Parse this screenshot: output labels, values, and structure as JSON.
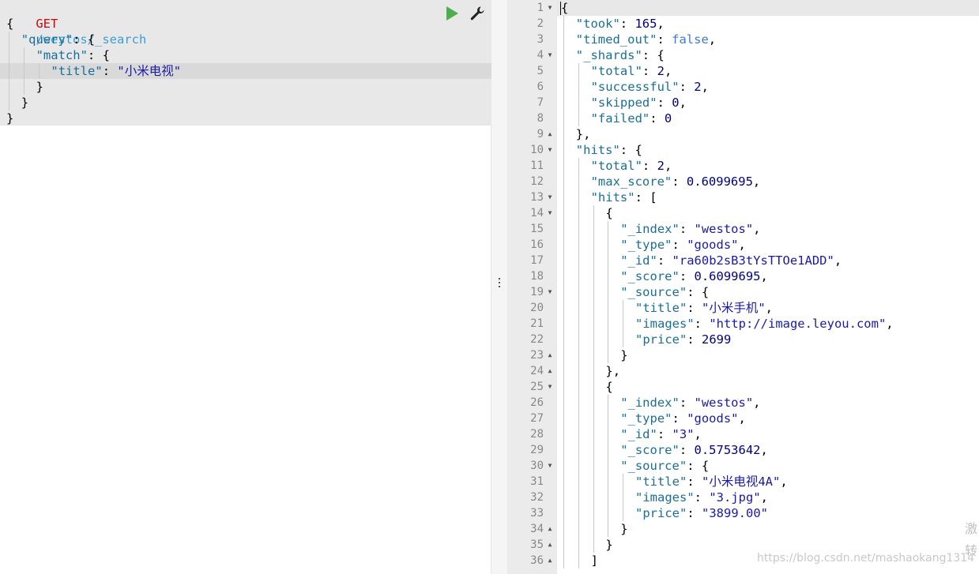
{
  "request": {
    "method": "GET",
    "path": "/westos/_search",
    "lines": [
      {
        "indent": 0,
        "parts": [
          {
            "t": "{",
            "c": ""
          }
        ]
      },
      {
        "indent": 1,
        "parts": [
          {
            "t": "\"query\"",
            "c": "key"
          },
          {
            "t": ": {",
            "c": ""
          }
        ]
      },
      {
        "indent": 2,
        "parts": [
          {
            "t": "\"match\"",
            "c": "key"
          },
          {
            "t": ": {",
            "c": ""
          }
        ]
      },
      {
        "indent": 3,
        "parts": [
          {
            "t": "\"title\"",
            "c": "key"
          },
          {
            "t": ": ",
            "c": ""
          },
          {
            "t": "\"小米电视\"",
            "c": "str"
          }
        ]
      },
      {
        "indent": 2,
        "parts": [
          {
            "t": "}",
            "c": ""
          }
        ]
      },
      {
        "indent": 1,
        "parts": [
          {
            "t": "}",
            "c": ""
          }
        ]
      },
      {
        "indent": 0,
        "parts": [
          {
            "t": "}",
            "c": ""
          }
        ]
      }
    ],
    "icons": {
      "run": "play-icon",
      "settings": "wrench-icon"
    },
    "colors": {
      "run": "#4cae4c",
      "method": "#c5060b",
      "path": "#3a9fd6"
    }
  },
  "response": {
    "lines": [
      {
        "n": "1",
        "fold": "open",
        "indent": 0,
        "parts": [
          {
            "t": "{",
            "c": ""
          }
        ]
      },
      {
        "n": "2",
        "indent": 1,
        "parts": [
          {
            "t": "\"took\"",
            "c": "key"
          },
          {
            "t": ": ",
            "c": ""
          },
          {
            "t": "165",
            "c": "num"
          },
          {
            "t": ",",
            "c": ""
          }
        ]
      },
      {
        "n": "3",
        "indent": 1,
        "parts": [
          {
            "t": "\"timed_out\"",
            "c": "key"
          },
          {
            "t": ": ",
            "c": ""
          },
          {
            "t": "false",
            "c": "bool"
          },
          {
            "t": ",",
            "c": ""
          }
        ]
      },
      {
        "n": "4",
        "fold": "open",
        "indent": 1,
        "parts": [
          {
            "t": "\"_shards\"",
            "c": "key"
          },
          {
            "t": ": {",
            "c": ""
          }
        ]
      },
      {
        "n": "5",
        "indent": 2,
        "parts": [
          {
            "t": "\"total\"",
            "c": "key"
          },
          {
            "t": ": ",
            "c": ""
          },
          {
            "t": "2",
            "c": "num"
          },
          {
            "t": ",",
            "c": ""
          }
        ]
      },
      {
        "n": "6",
        "indent": 2,
        "parts": [
          {
            "t": "\"successful\"",
            "c": "key"
          },
          {
            "t": ": ",
            "c": ""
          },
          {
            "t": "2",
            "c": "num"
          },
          {
            "t": ",",
            "c": ""
          }
        ]
      },
      {
        "n": "7",
        "indent": 2,
        "parts": [
          {
            "t": "\"skipped\"",
            "c": "key"
          },
          {
            "t": ": ",
            "c": ""
          },
          {
            "t": "0",
            "c": "num"
          },
          {
            "t": ",",
            "c": ""
          }
        ]
      },
      {
        "n": "8",
        "indent": 2,
        "parts": [
          {
            "t": "\"failed\"",
            "c": "key"
          },
          {
            "t": ": ",
            "c": ""
          },
          {
            "t": "0",
            "c": "num"
          }
        ]
      },
      {
        "n": "9",
        "fold": "close",
        "indent": 1,
        "parts": [
          {
            "t": "},",
            "c": ""
          }
        ]
      },
      {
        "n": "10",
        "fold": "open",
        "indent": 1,
        "parts": [
          {
            "t": "\"hits\"",
            "c": "key"
          },
          {
            "t": ": {",
            "c": ""
          }
        ]
      },
      {
        "n": "11",
        "indent": 2,
        "parts": [
          {
            "t": "\"total\"",
            "c": "key"
          },
          {
            "t": ": ",
            "c": ""
          },
          {
            "t": "2",
            "c": "num"
          },
          {
            "t": ",",
            "c": ""
          }
        ]
      },
      {
        "n": "12",
        "indent": 2,
        "parts": [
          {
            "t": "\"max_score\"",
            "c": "key"
          },
          {
            "t": ": ",
            "c": ""
          },
          {
            "t": "0.6099695",
            "c": "num"
          },
          {
            "t": ",",
            "c": ""
          }
        ]
      },
      {
        "n": "13",
        "fold": "open",
        "indent": 2,
        "parts": [
          {
            "t": "\"hits\"",
            "c": "key"
          },
          {
            "t": ": [",
            "c": ""
          }
        ]
      },
      {
        "n": "14",
        "fold": "open",
        "indent": 3,
        "parts": [
          {
            "t": "{",
            "c": ""
          }
        ]
      },
      {
        "n": "15",
        "indent": 4,
        "parts": [
          {
            "t": "\"_index\"",
            "c": "key"
          },
          {
            "t": ": ",
            "c": ""
          },
          {
            "t": "\"westos\"",
            "c": "str"
          },
          {
            "t": ",",
            "c": ""
          }
        ]
      },
      {
        "n": "16",
        "indent": 4,
        "parts": [
          {
            "t": "\"_type\"",
            "c": "key"
          },
          {
            "t": ": ",
            "c": ""
          },
          {
            "t": "\"goods\"",
            "c": "str"
          },
          {
            "t": ",",
            "c": ""
          }
        ]
      },
      {
        "n": "17",
        "indent": 4,
        "parts": [
          {
            "t": "\"_id\"",
            "c": "key"
          },
          {
            "t": ": ",
            "c": ""
          },
          {
            "t": "\"ra60b2sB3tYsTTOe1ADD\"",
            "c": "str"
          },
          {
            "t": ",",
            "c": ""
          }
        ]
      },
      {
        "n": "18",
        "indent": 4,
        "parts": [
          {
            "t": "\"_score\"",
            "c": "key"
          },
          {
            "t": ": ",
            "c": ""
          },
          {
            "t": "0.6099695",
            "c": "num"
          },
          {
            "t": ",",
            "c": ""
          }
        ]
      },
      {
        "n": "19",
        "fold": "open",
        "indent": 4,
        "parts": [
          {
            "t": "\"_source\"",
            "c": "key"
          },
          {
            "t": ": {",
            "c": ""
          }
        ]
      },
      {
        "n": "20",
        "indent": 5,
        "parts": [
          {
            "t": "\"title\"",
            "c": "key"
          },
          {
            "t": ": ",
            "c": ""
          },
          {
            "t": "\"小米手机\"",
            "c": "str"
          },
          {
            "t": ",",
            "c": ""
          }
        ]
      },
      {
        "n": "21",
        "indent": 5,
        "parts": [
          {
            "t": "\"images\"",
            "c": "key"
          },
          {
            "t": ": ",
            "c": ""
          },
          {
            "t": "\"http://image.leyou.com\"",
            "c": "str"
          },
          {
            "t": ",",
            "c": ""
          }
        ]
      },
      {
        "n": "22",
        "indent": 5,
        "parts": [
          {
            "t": "\"price\"",
            "c": "key"
          },
          {
            "t": ": ",
            "c": ""
          },
          {
            "t": "2699",
            "c": "num"
          }
        ]
      },
      {
        "n": "23",
        "fold": "close",
        "indent": 4,
        "parts": [
          {
            "t": "}",
            "c": ""
          }
        ]
      },
      {
        "n": "24",
        "fold": "close",
        "indent": 3,
        "parts": [
          {
            "t": "},",
            "c": ""
          }
        ]
      },
      {
        "n": "25",
        "fold": "open",
        "indent": 3,
        "parts": [
          {
            "t": "{",
            "c": ""
          }
        ]
      },
      {
        "n": "26",
        "indent": 4,
        "parts": [
          {
            "t": "\"_index\"",
            "c": "key"
          },
          {
            "t": ": ",
            "c": ""
          },
          {
            "t": "\"westos\"",
            "c": "str"
          },
          {
            "t": ",",
            "c": ""
          }
        ]
      },
      {
        "n": "27",
        "indent": 4,
        "parts": [
          {
            "t": "\"_type\"",
            "c": "key"
          },
          {
            "t": ": ",
            "c": ""
          },
          {
            "t": "\"goods\"",
            "c": "str"
          },
          {
            "t": ",",
            "c": ""
          }
        ]
      },
      {
        "n": "28",
        "indent": 4,
        "parts": [
          {
            "t": "\"_id\"",
            "c": "key"
          },
          {
            "t": ": ",
            "c": ""
          },
          {
            "t": "\"3\"",
            "c": "str"
          },
          {
            "t": ",",
            "c": ""
          }
        ]
      },
      {
        "n": "29",
        "indent": 4,
        "parts": [
          {
            "t": "\"_score\"",
            "c": "key"
          },
          {
            "t": ": ",
            "c": ""
          },
          {
            "t": "0.5753642",
            "c": "num"
          },
          {
            "t": ",",
            "c": ""
          }
        ]
      },
      {
        "n": "30",
        "fold": "open",
        "indent": 4,
        "parts": [
          {
            "t": "\"_source\"",
            "c": "key"
          },
          {
            "t": ": {",
            "c": ""
          }
        ]
      },
      {
        "n": "31",
        "indent": 5,
        "parts": [
          {
            "t": "\"title\"",
            "c": "key"
          },
          {
            "t": ": ",
            "c": ""
          },
          {
            "t": "\"小米电视4A\"",
            "c": "str"
          },
          {
            "t": ",",
            "c": ""
          }
        ]
      },
      {
        "n": "32",
        "indent": 5,
        "parts": [
          {
            "t": "\"images\"",
            "c": "key"
          },
          {
            "t": ": ",
            "c": ""
          },
          {
            "t": "\"3.jpg\"",
            "c": "str"
          },
          {
            "t": ",",
            "c": ""
          }
        ]
      },
      {
        "n": "33",
        "indent": 5,
        "parts": [
          {
            "t": "\"price\"",
            "c": "key"
          },
          {
            "t": ": ",
            "c": ""
          },
          {
            "t": "\"3899.00\"",
            "c": "str"
          }
        ]
      },
      {
        "n": "34",
        "fold": "close",
        "indent": 4,
        "parts": [
          {
            "t": "}",
            "c": ""
          }
        ]
      },
      {
        "n": "35",
        "fold": "close",
        "indent": 3,
        "parts": [
          {
            "t": "}",
            "c": ""
          }
        ]
      },
      {
        "n": "36",
        "fold": "close",
        "indent": 2,
        "parts": [
          {
            "t": "]",
            "c": ""
          }
        ]
      }
    ]
  },
  "watermark": "https://blog.csdn.net/mashaokang1314",
  "side_text": "激转"
}
